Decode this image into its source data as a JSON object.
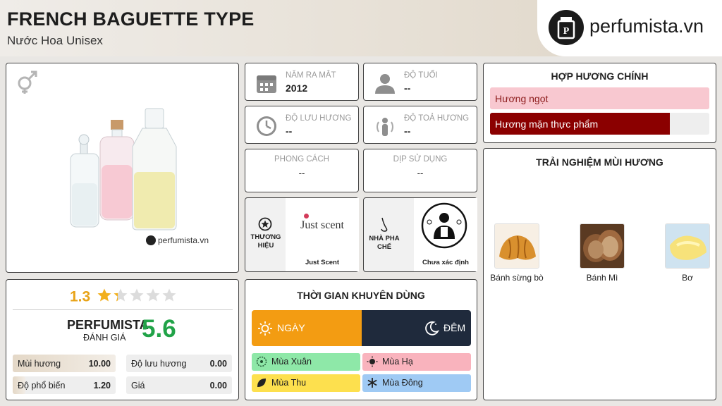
{
  "header": {
    "title": "FRENCH BAGUETTE TYPE",
    "subtitle": "Nước Hoa Unisex",
    "logo_text": "perfumista.vn"
  },
  "product": {
    "watermark": "perfumista.vn",
    "gender_icon": "unisex-gender-icon"
  },
  "info": {
    "launch_label": "NĂM RA MẮT",
    "launch_value": "2012",
    "age_label": "ĐỘ TUỔI",
    "age_value": "--",
    "longevity_label": "ĐỘ LƯU HƯƠNG",
    "longevity_value": "--",
    "sillage_label": "ĐỘ TOẢ HƯƠNG",
    "sillage_value": "--",
    "style_label": "PHONG CÁCH",
    "style_value": "--",
    "occasion_label": "DỊP SỬ DỤNG",
    "occasion_value": "--",
    "brand_label": "THƯƠNG HIỆU",
    "brand_name": "Just Scent",
    "brand_logo_text": "Just scent",
    "perfumer_label": "NHÀ PHA CHẾ",
    "perfumer_name": "Chưa xác định"
  },
  "accords": {
    "title": "HỢP HƯƠNG CHÍNH",
    "items": [
      {
        "label": "Hương ngọt",
        "fill": 1.0,
        "color": "#f8c8d0"
      },
      {
        "label": "Hương mặn thực phẩm",
        "fill": 0.82,
        "color": "#8b0000"
      }
    ]
  },
  "notes": {
    "title": "TRẢI NGHIỆM MÙI HƯƠNG",
    "items": [
      "Bánh sừng bò",
      "Bánh Mì",
      "Bơ"
    ]
  },
  "rating": {
    "score": "1.3",
    "stars_filled": 1.3,
    "stars_total": 5,
    "brand": "PERFUMISTA",
    "label": "ĐÁNH GIÁ",
    "perfumista_score": "5.6",
    "rows": [
      {
        "label": "Mùi hương",
        "value": "10.00",
        "fill": 1.0
      },
      {
        "label": "Độ lưu hương",
        "value": "0.00",
        "fill": 0.0
      },
      {
        "label": "Độ phổ biến",
        "value": "1.20",
        "fill": 0.12
      },
      {
        "label": "Giá",
        "value": "0.00",
        "fill": 0.0
      }
    ]
  },
  "time": {
    "title": "THỜI GIAN KHUYÊN DÙNG",
    "day": "NGÀY",
    "night": "ĐÊM",
    "day_color": "#f39c12",
    "night_color": "#1f2a3c",
    "seasons": [
      {
        "label": "Mùa Xuân",
        "color": "#8ee8a8"
      },
      {
        "label": "Mùa Hạ",
        "color": "#f9b3bd"
      },
      {
        "label": "Mùa Thu",
        "color": "#fde04e"
      },
      {
        "label": "Mùa Đông",
        "color": "#9fcaf4"
      }
    ]
  }
}
